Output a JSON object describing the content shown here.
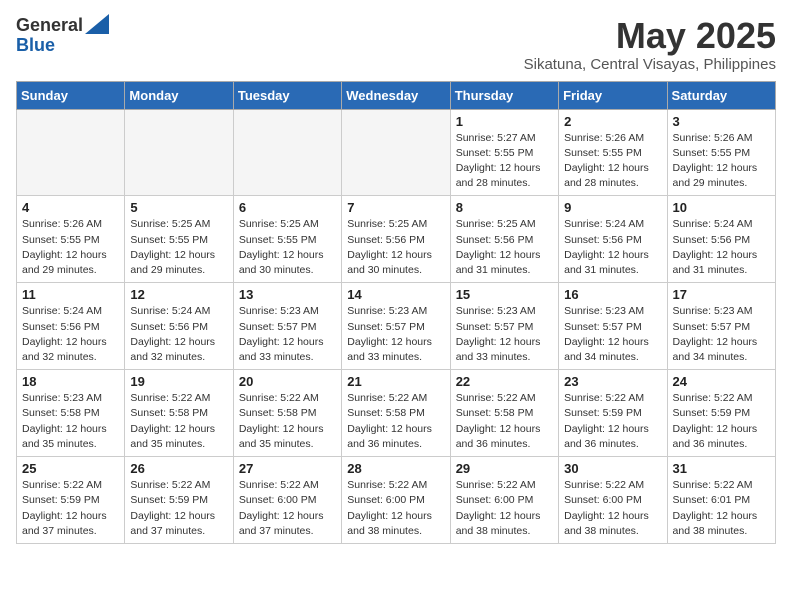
{
  "logo": {
    "general": "General",
    "blue": "Blue"
  },
  "title": "May 2025",
  "location": "Sikatuna, Central Visayas, Philippines",
  "weekdays": [
    "Sunday",
    "Monday",
    "Tuesday",
    "Wednesday",
    "Thursday",
    "Friday",
    "Saturday"
  ],
  "weeks": [
    [
      {
        "day": "",
        "info": ""
      },
      {
        "day": "",
        "info": ""
      },
      {
        "day": "",
        "info": ""
      },
      {
        "day": "",
        "info": ""
      },
      {
        "day": "1",
        "info": "Sunrise: 5:27 AM\nSunset: 5:55 PM\nDaylight: 12 hours and 28 minutes."
      },
      {
        "day": "2",
        "info": "Sunrise: 5:26 AM\nSunset: 5:55 PM\nDaylight: 12 hours and 28 minutes."
      },
      {
        "day": "3",
        "info": "Sunrise: 5:26 AM\nSunset: 5:55 PM\nDaylight: 12 hours and 29 minutes."
      }
    ],
    [
      {
        "day": "4",
        "info": "Sunrise: 5:26 AM\nSunset: 5:55 PM\nDaylight: 12 hours and 29 minutes."
      },
      {
        "day": "5",
        "info": "Sunrise: 5:25 AM\nSunset: 5:55 PM\nDaylight: 12 hours and 29 minutes."
      },
      {
        "day": "6",
        "info": "Sunrise: 5:25 AM\nSunset: 5:55 PM\nDaylight: 12 hours and 30 minutes."
      },
      {
        "day": "7",
        "info": "Sunrise: 5:25 AM\nSunset: 5:56 PM\nDaylight: 12 hours and 30 minutes."
      },
      {
        "day": "8",
        "info": "Sunrise: 5:25 AM\nSunset: 5:56 PM\nDaylight: 12 hours and 31 minutes."
      },
      {
        "day": "9",
        "info": "Sunrise: 5:24 AM\nSunset: 5:56 PM\nDaylight: 12 hours and 31 minutes."
      },
      {
        "day": "10",
        "info": "Sunrise: 5:24 AM\nSunset: 5:56 PM\nDaylight: 12 hours and 31 minutes."
      }
    ],
    [
      {
        "day": "11",
        "info": "Sunrise: 5:24 AM\nSunset: 5:56 PM\nDaylight: 12 hours and 32 minutes."
      },
      {
        "day": "12",
        "info": "Sunrise: 5:24 AM\nSunset: 5:56 PM\nDaylight: 12 hours and 32 minutes."
      },
      {
        "day": "13",
        "info": "Sunrise: 5:23 AM\nSunset: 5:57 PM\nDaylight: 12 hours and 33 minutes."
      },
      {
        "day": "14",
        "info": "Sunrise: 5:23 AM\nSunset: 5:57 PM\nDaylight: 12 hours and 33 minutes."
      },
      {
        "day": "15",
        "info": "Sunrise: 5:23 AM\nSunset: 5:57 PM\nDaylight: 12 hours and 33 minutes."
      },
      {
        "day": "16",
        "info": "Sunrise: 5:23 AM\nSunset: 5:57 PM\nDaylight: 12 hours and 34 minutes."
      },
      {
        "day": "17",
        "info": "Sunrise: 5:23 AM\nSunset: 5:57 PM\nDaylight: 12 hours and 34 minutes."
      }
    ],
    [
      {
        "day": "18",
        "info": "Sunrise: 5:23 AM\nSunset: 5:58 PM\nDaylight: 12 hours and 35 minutes."
      },
      {
        "day": "19",
        "info": "Sunrise: 5:22 AM\nSunset: 5:58 PM\nDaylight: 12 hours and 35 minutes."
      },
      {
        "day": "20",
        "info": "Sunrise: 5:22 AM\nSunset: 5:58 PM\nDaylight: 12 hours and 35 minutes."
      },
      {
        "day": "21",
        "info": "Sunrise: 5:22 AM\nSunset: 5:58 PM\nDaylight: 12 hours and 36 minutes."
      },
      {
        "day": "22",
        "info": "Sunrise: 5:22 AM\nSunset: 5:58 PM\nDaylight: 12 hours and 36 minutes."
      },
      {
        "day": "23",
        "info": "Sunrise: 5:22 AM\nSunset: 5:59 PM\nDaylight: 12 hours and 36 minutes."
      },
      {
        "day": "24",
        "info": "Sunrise: 5:22 AM\nSunset: 5:59 PM\nDaylight: 12 hours and 36 minutes."
      }
    ],
    [
      {
        "day": "25",
        "info": "Sunrise: 5:22 AM\nSunset: 5:59 PM\nDaylight: 12 hours and 37 minutes."
      },
      {
        "day": "26",
        "info": "Sunrise: 5:22 AM\nSunset: 5:59 PM\nDaylight: 12 hours and 37 minutes."
      },
      {
        "day": "27",
        "info": "Sunrise: 5:22 AM\nSunset: 6:00 PM\nDaylight: 12 hours and 37 minutes."
      },
      {
        "day": "28",
        "info": "Sunrise: 5:22 AM\nSunset: 6:00 PM\nDaylight: 12 hours and 38 minutes."
      },
      {
        "day": "29",
        "info": "Sunrise: 5:22 AM\nSunset: 6:00 PM\nDaylight: 12 hours and 38 minutes."
      },
      {
        "day": "30",
        "info": "Sunrise: 5:22 AM\nSunset: 6:00 PM\nDaylight: 12 hours and 38 minutes."
      },
      {
        "day": "31",
        "info": "Sunrise: 5:22 AM\nSunset: 6:01 PM\nDaylight: 12 hours and 38 minutes."
      }
    ]
  ]
}
